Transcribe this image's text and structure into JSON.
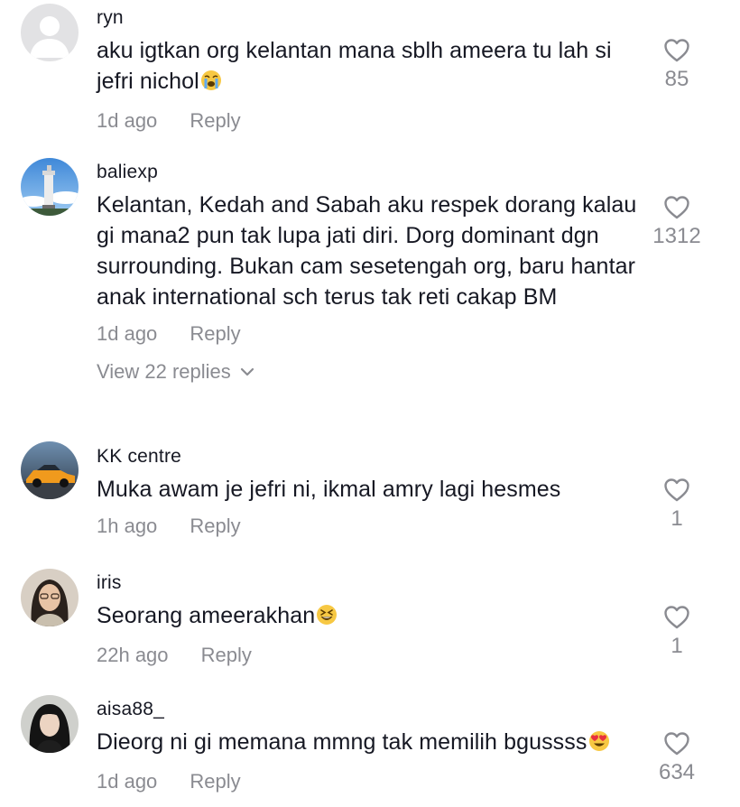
{
  "comments": [
    {
      "username": "ryn",
      "text": "aku igtkan org kelantan mana sblh ameera tu lah si jefri nichol",
      "emoji": "loudly-crying-face",
      "time": "1d ago",
      "reply_label": "Reply",
      "likes": "85",
      "avatar": "default-avatar"
    },
    {
      "username": "baliexp",
      "text": "Kelantan, Kedah and Sabah aku respek dorang kalau gi mana2 pun tak lupa jati diri. Dorg dominant dgn surrounding. Bukan cam sesetengah org, baru hantar anak international sch terus tak reti cakap BM",
      "time": "1d ago",
      "reply_label": "Reply",
      "likes": "1312",
      "view_replies": "View 22 replies",
      "avatar": "lighthouse-photo"
    },
    {
      "username": "KK centre",
      "text": "Muka awam je jefri ni, ikmal amry lagi hesmes",
      "time": "1h ago",
      "reply_label": "Reply",
      "likes": "1",
      "avatar": "orange-car-photo"
    },
    {
      "username": "iris",
      "text": "Seorang ameerakhan",
      "emoji": "grinning-squinting-face",
      "time": "22h ago",
      "reply_label": "Reply",
      "likes": "1",
      "avatar": "woman-glasses-photo"
    },
    {
      "username": "aisa88_",
      "text": "Dieorg ni gi memana mmng tak memilih bgussss",
      "emoji": "heart-eyes-face",
      "time": "1d ago",
      "reply_label": "Reply",
      "likes": "634",
      "avatar": "woman-portrait-photo"
    }
  ],
  "colors": {
    "text": "#161823",
    "muted": "#8a8b91",
    "background": "#ffffff"
  },
  "icons": {
    "like": "heart-outline-icon",
    "expand": "chevron-down-icon"
  }
}
